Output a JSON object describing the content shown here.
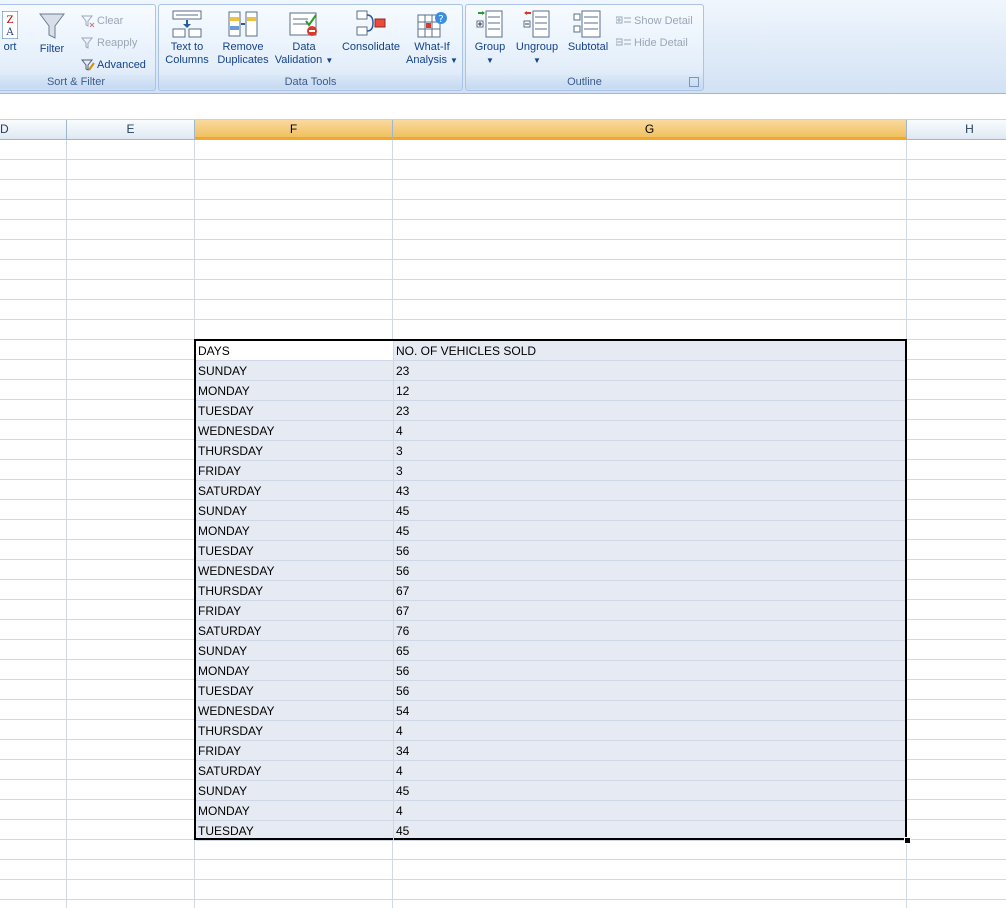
{
  "ribbon": {
    "sort_filter": {
      "sort_label": "ort",
      "filter_label": "Filter",
      "clear_label": "Clear",
      "reapply_label": "Reapply",
      "advanced_label": "Advanced",
      "group_label": "Sort & Filter"
    },
    "data_tools": {
      "text_to_columns": [
        "Text to",
        "Columns"
      ],
      "remove_duplicates": [
        "Remove",
        "Duplicates"
      ],
      "data_validation": [
        "Data",
        "Validation"
      ],
      "consolidate": "Consolidate",
      "what_if": [
        "What-If",
        "Analysis"
      ],
      "group_label": "Data Tools"
    },
    "outline": {
      "group": "Group",
      "ungroup": "Ungroup",
      "subtotal": "Subtotal",
      "show_detail": "Show Detail",
      "hide_detail": "Hide Detail",
      "group_label": "Outline"
    }
  },
  "columns": [
    "D",
    "E",
    "F",
    "G",
    "H"
  ],
  "selected_columns": [
    "F",
    "G"
  ],
  "table": {
    "headers": [
      "DAYS",
      "NO. OF VEHICLES SOLD"
    ],
    "rows": [
      [
        "SUNDAY",
        "23"
      ],
      [
        "MONDAY",
        "12"
      ],
      [
        "TUESDAY",
        "23"
      ],
      [
        "WEDNESDAY",
        "4"
      ],
      [
        "THURSDAY",
        "3"
      ],
      [
        "FRIDAY",
        "3"
      ],
      [
        "SATURDAY",
        "43"
      ],
      [
        "SUNDAY",
        "45"
      ],
      [
        "MONDAY",
        "45"
      ],
      [
        "TUESDAY",
        "56"
      ],
      [
        "WEDNESDAY",
        "56"
      ],
      [
        "THURSDAY",
        "67"
      ],
      [
        "FRIDAY",
        "67"
      ],
      [
        "SATURDAY",
        "76"
      ],
      [
        "SUNDAY",
        "65"
      ],
      [
        "MONDAY",
        "56"
      ],
      [
        "TUESDAY",
        "56"
      ],
      [
        "WEDNESDAY",
        "54"
      ],
      [
        "THURSDAY",
        "4"
      ],
      [
        "FRIDAY",
        "34"
      ],
      [
        "SATURDAY",
        "4"
      ],
      [
        "SUNDAY",
        "45"
      ],
      [
        "MONDAY",
        "4"
      ],
      [
        "TUESDAY",
        "45"
      ]
    ]
  },
  "colors": {
    "selection_fill": "#e6eaf3",
    "header_selected": "#f1c15f",
    "gridline": "#d0d7e5"
  }
}
